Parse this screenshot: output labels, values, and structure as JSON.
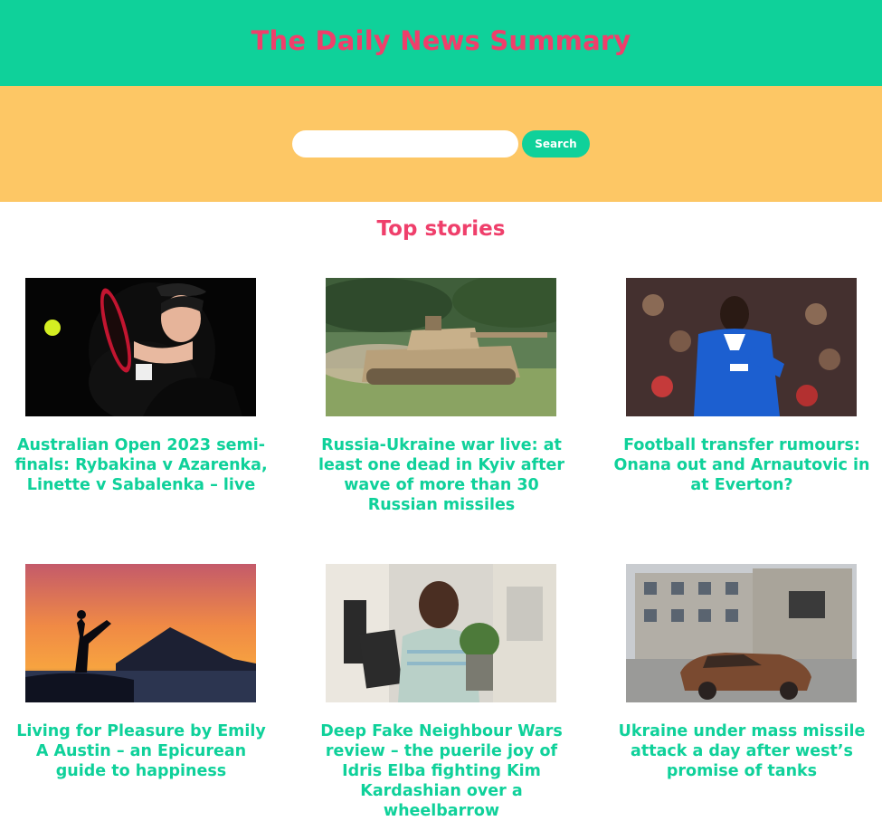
{
  "header": {
    "title": "The Daily News Summary"
  },
  "search": {
    "placeholder": "",
    "value": "",
    "button_label": "Search"
  },
  "section": {
    "title": "Top stories"
  },
  "stories": [
    {
      "headline": "Australian Open 2023 semi-finals: Rybakina v Azarenka, Linette v Sabalenka – live",
      "image": "tennis-player-photo"
    },
    {
      "headline": "Russia-Ukraine war live: at least one dead in Kyiv after wave of more than 30 Russian missiles",
      "image": "tank-photo"
    },
    {
      "headline": "Football transfer rumours: Onana out and Arnautovic in at Everton?",
      "image": "footballer-photo"
    },
    {
      "headline": "Living for Pleasure by Emily A Austin – an Epicurean guide to happiness",
      "image": "yoga-sunset-photo"
    },
    {
      "headline": "Deep Fake Neighbour Wars review – the puerile joy of Idris Elba fighting Kim Kardashian over a wheelbarrow",
      "image": "man-with-plant-photo"
    },
    {
      "headline": "Ukraine under mass missile attack a day after west’s promise of tanks",
      "image": "burnt-car-photo"
    }
  ],
  "colors": {
    "header_bg": "#0fd19a",
    "search_band_bg": "#fdc765",
    "title": "#ef3f6b",
    "headline": "#0fd19a"
  }
}
